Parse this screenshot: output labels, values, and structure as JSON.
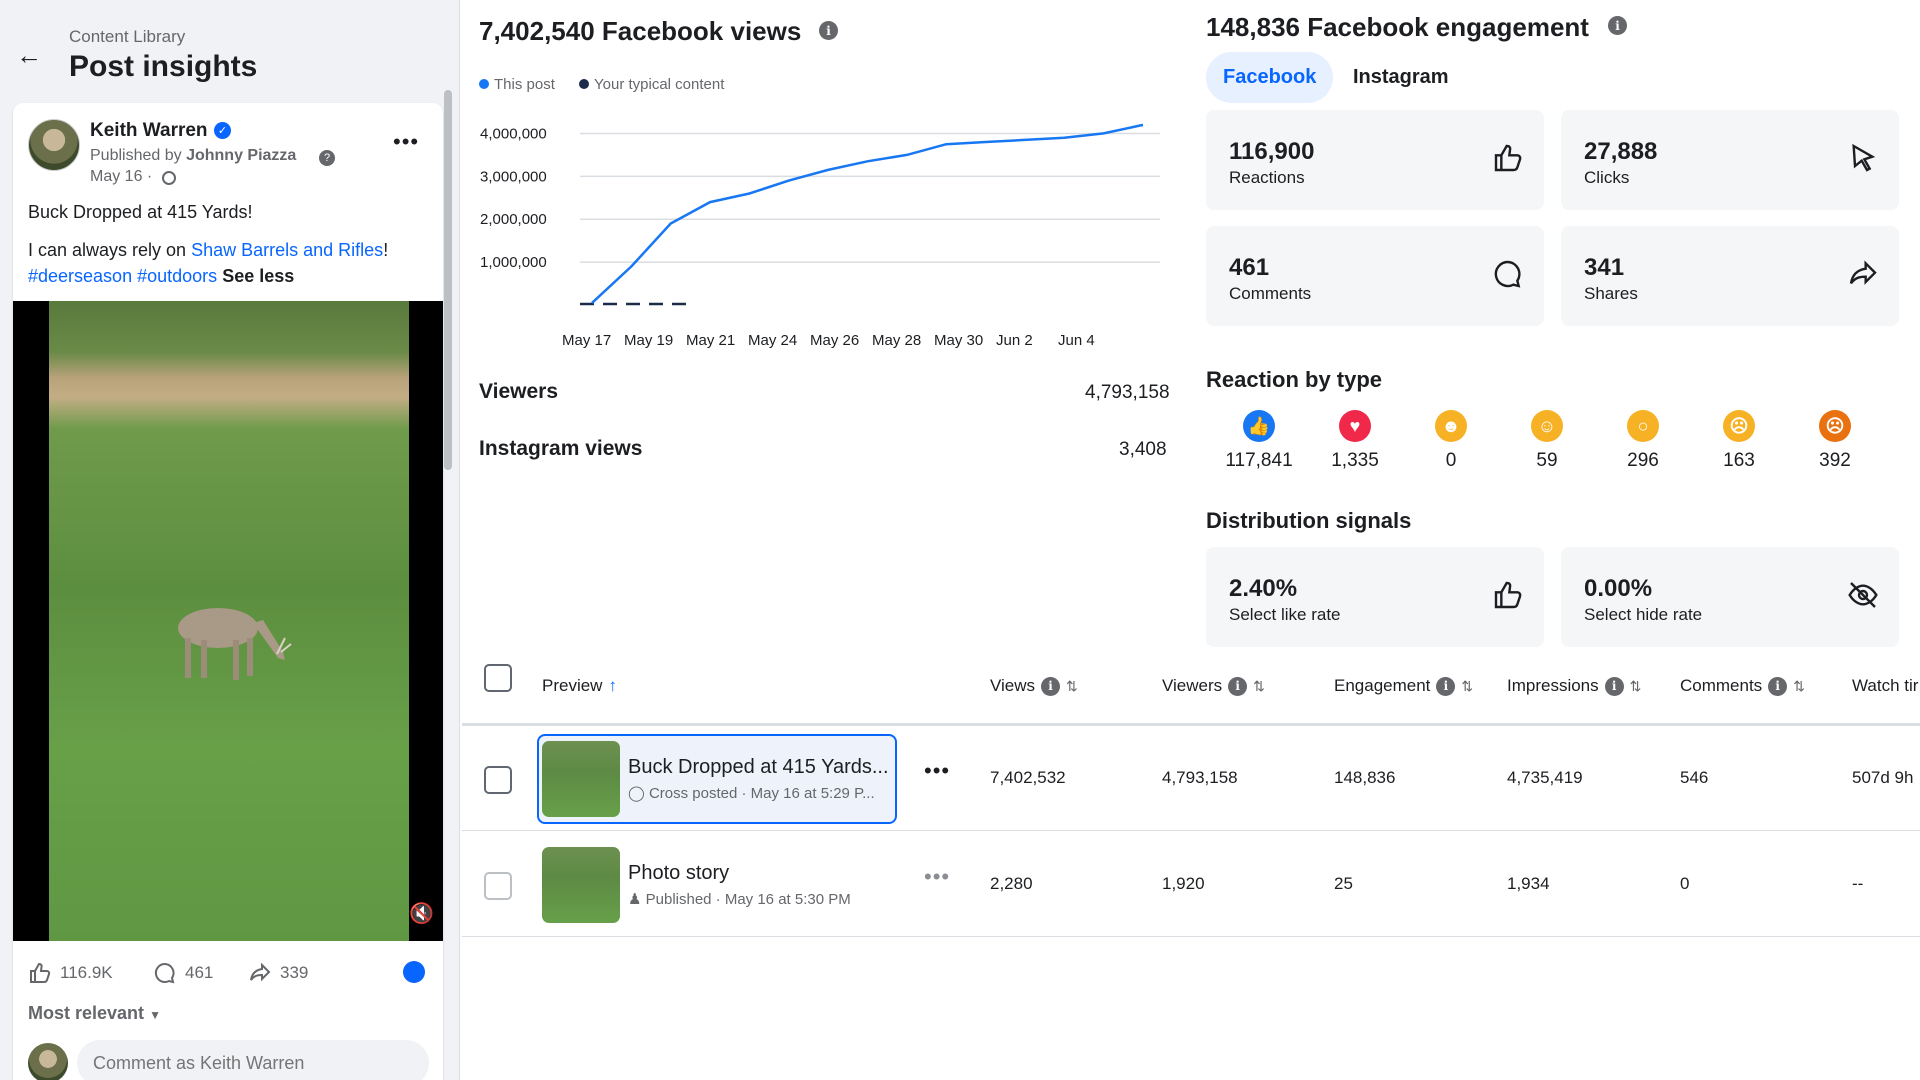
{
  "header": {
    "back_icon": "arrow-left-icon",
    "breadcrumb": "Content Library",
    "title": "Post insights"
  },
  "post": {
    "author": "Keith Warren",
    "published_by_prefix": "Published by",
    "publisher": "Johnny Piazza",
    "date": "May 16 ·",
    "line1": "Buck Dropped at 415 Yards!",
    "line2_prefix": "I can always rely on",
    "line2_link": "Shaw Barrels and Rifles",
    "line2_suffix": "!",
    "hashtag1": "#deerseason",
    "hashtag2": "#outdoors",
    "see_less": "See less",
    "likes": "116.9K",
    "comments": "461",
    "shares": "339",
    "sort_label": "Most relevant",
    "comment_placeholder": "Comment as Keith Warren"
  },
  "views": {
    "title": "7,402,540 Facebook views",
    "legend_this": "This post",
    "legend_typical": "Your typical content",
    "viewers_label": "Viewers",
    "viewers_value": "4,793,158",
    "ig_label": "Instagram views",
    "ig_value": "3,408"
  },
  "chart_data": {
    "type": "line",
    "x": [
      "May 17",
      "May 19",
      "May 21",
      "May 24",
      "May 26",
      "May 28",
      "May 30",
      "Jun 2",
      "Jun 4"
    ],
    "y_ticks": [
      "4,000,000",
      "3,000,000",
      "2,000,000",
      "1,000,000"
    ],
    "ylim": [
      0,
      4500000
    ],
    "series": [
      {
        "name": "This post",
        "color": "#1877f2",
        "values": [
          50000,
          900000,
          1900000,
          2400000,
          2600000,
          2900000,
          3150000,
          3350000,
          3500000,
          3750000,
          3800000,
          3850000,
          3900000,
          4000000,
          4200000
        ]
      },
      {
        "name": "Your typical content",
        "color": "#1c2b4a",
        "dashed": true,
        "values": [
          0,
          0,
          0,
          0
        ]
      }
    ]
  },
  "engagement": {
    "title": "148,836 Facebook engagement",
    "tab_facebook": "Facebook",
    "tab_instagram": "Instagram",
    "reactions_value": "116,900",
    "reactions_label": "Reactions",
    "clicks_value": "27,888",
    "clicks_label": "Clicks",
    "comments_value": "461",
    "comments_label": "Comments",
    "shares_value": "341",
    "shares_label": "Shares",
    "reaction_title": "Reaction by type",
    "reactions": [
      {
        "icon": "like-icon",
        "color": "#1877f2",
        "value": "117,841"
      },
      {
        "icon": "love-icon",
        "color": "#f02849",
        "value": "1,335"
      },
      {
        "icon": "care-icon",
        "color": "#f7b125",
        "value": "0"
      },
      {
        "icon": "haha-icon",
        "color": "#f7b125",
        "value": "59"
      },
      {
        "icon": "wow-icon",
        "color": "#f7b125",
        "value": "296"
      },
      {
        "icon": "sad-icon",
        "color": "#f7b125",
        "value": "163"
      },
      {
        "icon": "angry-icon",
        "color": "#e9710f",
        "value": "392"
      }
    ],
    "dist_title": "Distribution signals",
    "like_rate_value": "2.40%",
    "like_rate_label": "Select like rate",
    "hide_rate_value": "0.00%",
    "hide_rate_label": "Select hide rate"
  },
  "table": {
    "headers": [
      "Preview",
      "Views",
      "Viewers",
      "Engagement",
      "Impressions",
      "Comments",
      "Watch tir"
    ],
    "rows": [
      {
        "title": "Buck Dropped at 415 Yards...",
        "sub": "Cross posted · May 16 at 5:29 P...",
        "views": "7,402,532",
        "viewers": "4,793,158",
        "engagement": "148,836",
        "impressions": "4,735,419",
        "comments": "546",
        "watch": "507d 9h"
      },
      {
        "title": "Photo story",
        "sub": "Published · May 16 at 5:30 PM",
        "views": "2,280",
        "viewers": "1,920",
        "engagement": "25",
        "impressions": "1,934",
        "comments": "0",
        "watch": "--"
      }
    ]
  }
}
